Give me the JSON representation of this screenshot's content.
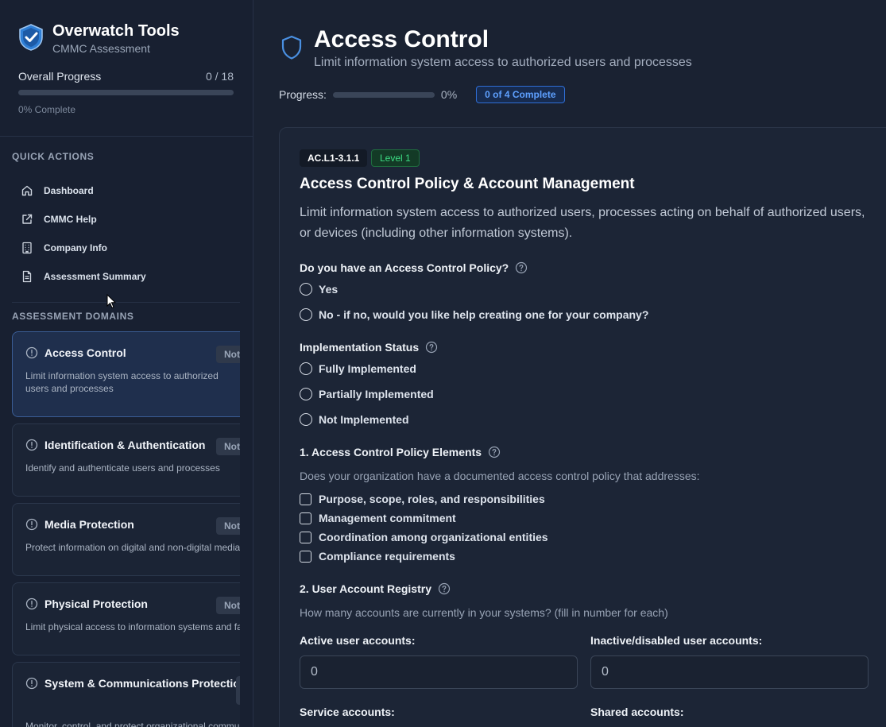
{
  "app": {
    "title": "Overwatch Tools",
    "subtitle": "CMMC Assessment"
  },
  "overall": {
    "label": "Overall Progress",
    "count": "0 / 18",
    "progress_fraction": 0,
    "percent_label": "0% Complete"
  },
  "quick_actions": {
    "title": "QUICK ACTIONS",
    "items": [
      {
        "label": "Dashboard",
        "icon": "home-icon"
      },
      {
        "label": "CMMC Help",
        "icon": "external-link-icon"
      },
      {
        "label": "Company Info",
        "icon": "building-icon"
      },
      {
        "label": "Assessment Summary",
        "icon": "document-icon"
      }
    ]
  },
  "domains": {
    "title": "ASSESSMENT DOMAINS",
    "items": [
      {
        "title": "Access Control",
        "badge": "Not",
        "desc": "Limit information system access to authorized users and processes",
        "active": true
      },
      {
        "title": "Identification & Authentication",
        "badge": "Not",
        "desc": "Identify and authenticate users and processes",
        "active": false
      },
      {
        "title": "Media Protection",
        "badge": "Not",
        "desc": "Protect information on digital and non-digital media",
        "active": false
      },
      {
        "title": "Physical Protection",
        "badge": "Not",
        "desc": "Limit physical access to information systems and facilities",
        "active": false
      },
      {
        "title": "System & Communications Protection",
        "badge": "",
        "desc": "Monitor, control, and protect organizational communications",
        "active": false
      }
    ]
  },
  "page": {
    "title": "Access Control",
    "subtitle": "Limit information system access to authorized users and processes",
    "progress_label": "Progress:",
    "progress_fraction": 0,
    "progress_pct": "0%",
    "complete_badge": "0 of 4 Complete"
  },
  "control": {
    "id": "AC.L1-3.1.1",
    "level": "Level 1",
    "title": "Access Control Policy & Account Management",
    "description": "Limit information system access to authorized users, processes acting on behalf of authorized users, or devices (including other information systems).",
    "q1": {
      "label": "Do you have an Access Control Policy?",
      "options": [
        "Yes",
        "No - if no, would you like help creating one for your company?"
      ]
    },
    "q2": {
      "label": "Implementation Status",
      "options": [
        "Fully Implemented",
        "Partially Implemented",
        "Not Implemented"
      ]
    },
    "q3": {
      "label": "1. Access Control Policy Elements",
      "hint": "Does your organization have a documented access control policy that addresses:",
      "options": [
        "Purpose, scope, roles, and responsibilities",
        "Management commitment",
        "Coordination among organizational entities",
        "Compliance requirements"
      ]
    },
    "q4": {
      "label": "2. User Account Registry",
      "hint": "How many accounts are currently in your systems? (fill in number for each)",
      "fields": [
        {
          "label": "Active user accounts:",
          "value": "0"
        },
        {
          "label": "Inactive/disabled user accounts:",
          "value": "0"
        },
        {
          "label": "Service accounts:",
          "value": ""
        },
        {
          "label": "Shared accounts:",
          "value": ""
        }
      ]
    }
  },
  "colors": {
    "accent": "#5ea0ff",
    "success": "#3ddc84",
    "background": "#1a2232",
    "sidebar": "#182031"
  }
}
